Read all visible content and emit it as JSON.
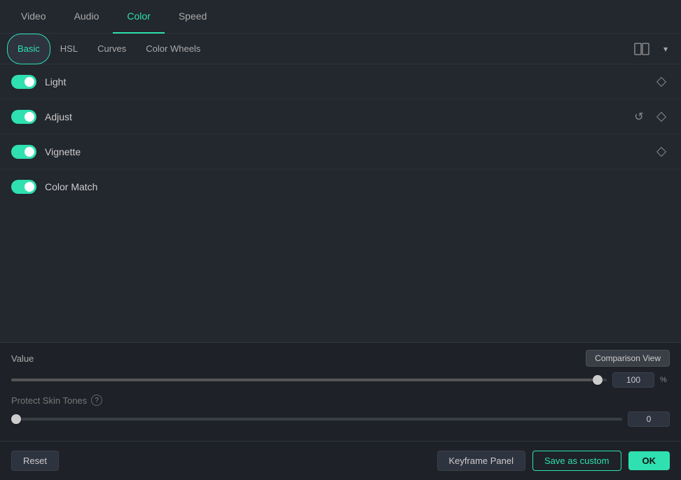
{
  "top_tabs": {
    "items": [
      {
        "label": "Video",
        "id": "video",
        "active": false
      },
      {
        "label": "Audio",
        "id": "audio",
        "active": false
      },
      {
        "label": "Color",
        "id": "color",
        "active": true
      },
      {
        "label": "Speed",
        "id": "speed",
        "active": false
      }
    ]
  },
  "sub_tabs": {
    "items": [
      {
        "label": "Basic",
        "id": "basic",
        "active": true
      },
      {
        "label": "HSL",
        "id": "hsl",
        "active": false
      },
      {
        "label": "Curves",
        "id": "curves",
        "active": false
      },
      {
        "label": "Color Wheels",
        "id": "color_wheels",
        "active": false
      }
    ]
  },
  "sections": [
    {
      "id": "light",
      "label": "Light",
      "enabled": true,
      "show_reset": false,
      "show_diamond": true
    },
    {
      "id": "adjust",
      "label": "Adjust",
      "enabled": true,
      "show_reset": true,
      "show_diamond": true
    },
    {
      "id": "vignette",
      "label": "Vignette",
      "enabled": true,
      "show_reset": false,
      "show_diamond": true
    },
    {
      "id": "color_match",
      "label": "Color Match",
      "enabled": true,
      "show_reset": false,
      "show_diamond": false
    }
  ],
  "value_slider": {
    "label": "Value",
    "value": 100,
    "percent_sign": "%",
    "fill_percent": 100,
    "thumb_percent": 98.5
  },
  "comparison_btn": {
    "label": "Comparison View"
  },
  "protect_skin": {
    "label": "Protect Skin Tones",
    "value": 0,
    "fill_percent": 0,
    "thumb_percent": 0
  },
  "footer": {
    "reset_label": "Reset",
    "keyframe_label": "Keyframe Panel",
    "save_custom_label": "Save as custom",
    "ok_label": "OK"
  },
  "icons": {
    "split_view": "⊟",
    "chevron_down": "▾",
    "help": "?",
    "reset": "↺"
  }
}
